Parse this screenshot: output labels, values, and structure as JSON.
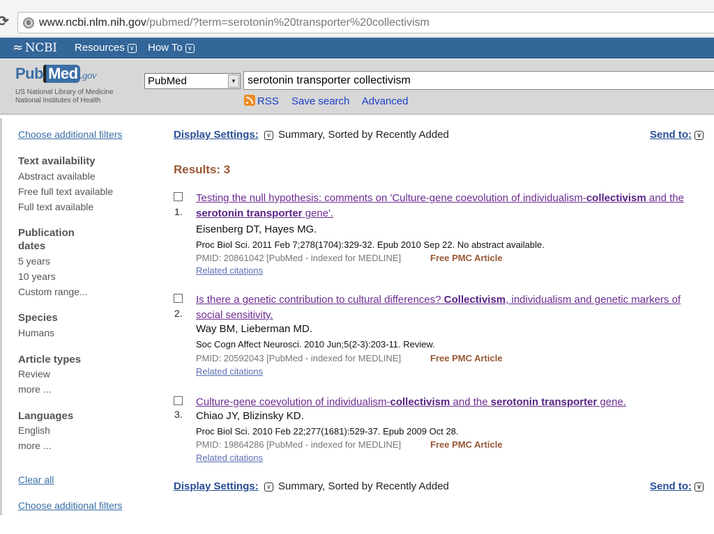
{
  "browser": {
    "url_host": "www.ncbi.nlm.nih.gov",
    "url_path": "/pubmed/?term=serotonin%20transporter%20collectivism"
  },
  "ncbi_bar": {
    "logo": "NCBI",
    "menu": [
      {
        "label": "Resources"
      },
      {
        "label": "How To"
      }
    ]
  },
  "header": {
    "logo_pub": "Pub",
    "logo_med": "Med",
    "logo_gov": ".gov",
    "subtitle_line1": "US National Library of Medicine",
    "subtitle_line2": "National Institutes of Health",
    "database": "PubMed",
    "search_term": "serotonin transporter collectivism",
    "links": {
      "rss": "RSS",
      "save_search": "Save search",
      "advanced": "Advanced"
    }
  },
  "sidebar": {
    "choose_filters": "Choose additional filters",
    "groups": [
      {
        "heading": "Text availability",
        "items": [
          "Abstract available",
          "Free full text available",
          "Full text available"
        ]
      },
      {
        "heading_line1": "Publication",
        "heading_line2": "dates",
        "items": [
          "5 years",
          "10 years",
          "Custom range..."
        ]
      },
      {
        "heading": "Species",
        "items": [
          "Humans"
        ]
      },
      {
        "heading": "Article types",
        "items": [
          "Review",
          "more ..."
        ]
      },
      {
        "heading": "Languages",
        "items": [
          "English",
          "more ..."
        ]
      }
    ],
    "clear_all": "Clear all",
    "choose_filters_bottom": "Choose additional filters"
  },
  "main": {
    "display_settings_label": "Display Settings:",
    "display_settings_value": "Summary, Sorted by Recently Added",
    "send_to": "Send to:",
    "results_count": "Results: 3",
    "results": [
      {
        "number": "1.",
        "title_parts": [
          "Testing the null hypothesis: comments on 'Culture-gene coevolution of individualism-",
          "collectivism",
          " and the ",
          "serotonin transporter",
          " gene'."
        ],
        "authors": "Eisenberg DT, Hayes MG.",
        "journal": "Proc Biol Sci. 2011 Feb 7;278(1704):329-32. Epub 2010 Sep 22. No abstract available.",
        "pmid": "PMID: 20861042 [PubMed - indexed for MEDLINE]",
        "free": "Free PMC Article",
        "related": "Related citations"
      },
      {
        "number": "2.",
        "title_parts": [
          "Is there a genetic contribution to cultural differences? ",
          "Collectivism",
          ", individualism and genetic markers of social sensitivity."
        ],
        "authors": "Way BM, Lieberman MD.",
        "journal": "Soc Cogn Affect Neurosci. 2010 Jun;5(2-3):203-11. Review.",
        "pmid": "PMID: 20592043 [PubMed - indexed for MEDLINE]",
        "free": "Free PMC Article",
        "related": "Related citations"
      },
      {
        "number": "3.",
        "title_parts": [
          "Culture-gene coevolution of individualism-",
          "collectivism",
          " and the ",
          "serotonin transporter",
          " gene."
        ],
        "authors": "Chiao JY, Blizinsky KD.",
        "journal": "Proc Biol Sci. 2010 Feb 22;277(1681):529-37. Epub 2009 Oct 28.",
        "pmid": "PMID: 19864286 [PubMed - indexed for MEDLINE]",
        "free": "Free PMC Article",
        "related": "Related citations"
      }
    ]
  },
  "colors": {
    "ncbi_bar": "#336699",
    "visited_link": "#6d2c91",
    "results_accent": "#985735",
    "link_blue": "#2a4e96"
  }
}
